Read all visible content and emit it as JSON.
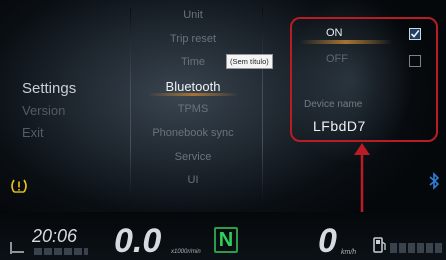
{
  "left_menu": {
    "items": [
      {
        "label": "Settings",
        "active": true
      },
      {
        "label": "Version",
        "active": false
      },
      {
        "label": "Exit",
        "active": false
      }
    ]
  },
  "middle_menu": {
    "items": [
      {
        "label": "Unit"
      },
      {
        "label": "Trip reset"
      },
      {
        "label": "Time"
      },
      {
        "label": "Bluetooth",
        "active": true
      },
      {
        "label": "TPMS"
      },
      {
        "label": "Phonebook sync"
      },
      {
        "label": "Service"
      },
      {
        "label": "UI"
      }
    ]
  },
  "tooltip": {
    "text": "(Sem título)"
  },
  "bluetooth_panel": {
    "options": [
      {
        "label": "ON",
        "checked": true
      },
      {
        "label": "OFF",
        "checked": false
      }
    ],
    "device_name_label": "Device name",
    "device_name_value": "LFbdD7"
  },
  "status_bar": {
    "clock": "20:06",
    "speed": "0.0",
    "speed_unit": "x1000r/min",
    "gear": "N",
    "speed2": "0",
    "speed2_unit": "km/h"
  },
  "colors": {
    "annotation": "#b81c24",
    "gear": "#2fd15a",
    "warning": "#e8c21a",
    "bluetooth": "#2f7fd6",
    "highlight": "#a77332"
  },
  "icons": {
    "warning": "tire-pressure-warning-icon",
    "bluetooth": "bluetooth-icon",
    "fuel": "fuel-pump-icon",
    "checkbox": "checkbox-icon"
  }
}
